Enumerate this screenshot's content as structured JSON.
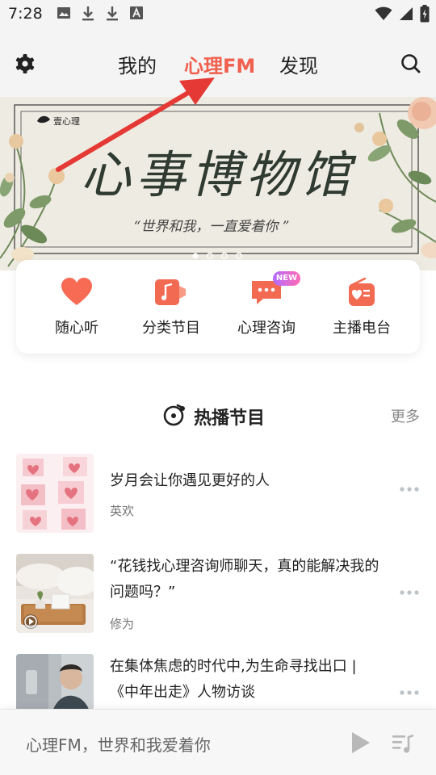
{
  "status_bar": {
    "time": "7:28",
    "icons_left": [
      "image-icon",
      "download-icon",
      "download-icon",
      "font-icon"
    ],
    "icons_right": [
      "wifi-icon",
      "signal-icon",
      "battery-charging-icon"
    ]
  },
  "header": {
    "tabs": [
      {
        "label": "我的",
        "active": false
      },
      {
        "label": "心理FM",
        "active": true
      },
      {
        "label": "发现",
        "active": false
      }
    ],
    "accent_color": "#f0604e"
  },
  "banner": {
    "brand": "壹心理",
    "title": "心事博物馆",
    "subtitle": "“世界和我，一直爱着你 ”",
    "dots_total": 4,
    "dots_active": 1
  },
  "quick_access": [
    {
      "label": "随心听",
      "icon": "heart-icon"
    },
    {
      "label": "分类节目",
      "icon": "music-note-icon"
    },
    {
      "label": "心理咨询",
      "icon": "chat-bubble-icon",
      "badge": "NEW"
    },
    {
      "label": "主播电台",
      "icon": "radio-icon"
    }
  ],
  "hot_section": {
    "title": "热播节目",
    "more_label": "更多"
  },
  "programs": [
    {
      "title": "岁月会让你遇见更好的人",
      "author": "英欢"
    },
    {
      "title": "“花钱找心理咨询师聊天，真的能解决我的问题吗？”",
      "author": "修为"
    },
    {
      "title": "在集体焦虑的时代中,为生命寻找出口 |《中年出走》人物访谈",
      "author": ""
    }
  ],
  "player": {
    "now_playing": "心理FM，世界和我爱着你"
  }
}
